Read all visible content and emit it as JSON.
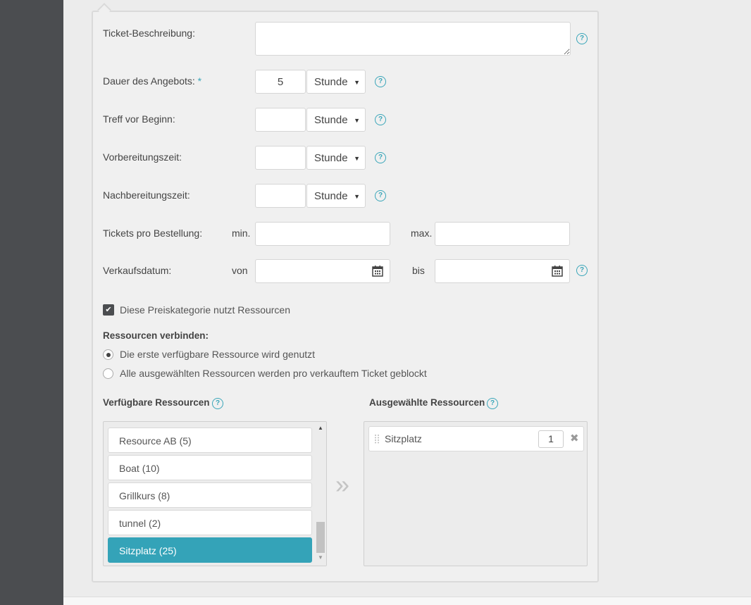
{
  "form": {
    "ticket_beschreibung_label": "Ticket-Beschreibung:",
    "ticket_beschreibung_value": "",
    "dauer_label": "Dauer des Angebots:",
    "required_marker": "*",
    "dauer_value": "5",
    "dauer_unit": "Stunde",
    "treff_label": "Treff vor Beginn:",
    "treff_value": "",
    "treff_unit": "Stunde",
    "vorbereitung_label": "Vorbereitungszeit:",
    "vorbereitung_value": "",
    "vorbereitung_unit": "Stunde",
    "nachbereitung_label": "Nachbereitungszeit:",
    "nachbereitung_value": "",
    "nachbereitung_unit": "Stunde",
    "tickets_label": "Tickets pro Bestellung:",
    "tickets_min_label": "min.",
    "tickets_max_label": "max.",
    "tickets_min_value": "",
    "tickets_max_value": "",
    "verkauf_label": "Verkaufsdatum:",
    "verkauf_von_label": "von",
    "verkauf_bis_label": "bis",
    "verkauf_von_value": "",
    "verkauf_bis_value": "",
    "help_glyph": "?"
  },
  "resources": {
    "uses_resources_label": "Diese Preiskategorie nutzt Ressourcen",
    "uses_resources_checked": true,
    "checkmark": "✔",
    "connect_heading": "Ressourcen verbinden:",
    "option_first": "Die erste verfügbare Ressource wird genutzt",
    "option_all": "Alle ausgewählten Ressourcen werden pro verkauftem Ticket geblockt",
    "selected_option": "first",
    "available_heading": "Verfügbare Ressourcen",
    "selected_heading": "Ausgewählte Ressourcen",
    "available": [
      "Resource AB (5)",
      "Boat (10)",
      "Grillkurs (8)",
      "tunnel (2)",
      "Sitzplatz (25)"
    ],
    "highlighted_index": 4,
    "move_glyph": "»",
    "selected_items": [
      {
        "label": "Sitzplatz",
        "qty": "1"
      }
    ],
    "remove_glyph": "✖",
    "scroll_up_glyph": "▲",
    "scroll_down_glyph": "▼",
    "select_arrow_glyph": "▼"
  },
  "colors": {
    "accent": "#34a3b8",
    "sidebar": "#4b4d50"
  }
}
